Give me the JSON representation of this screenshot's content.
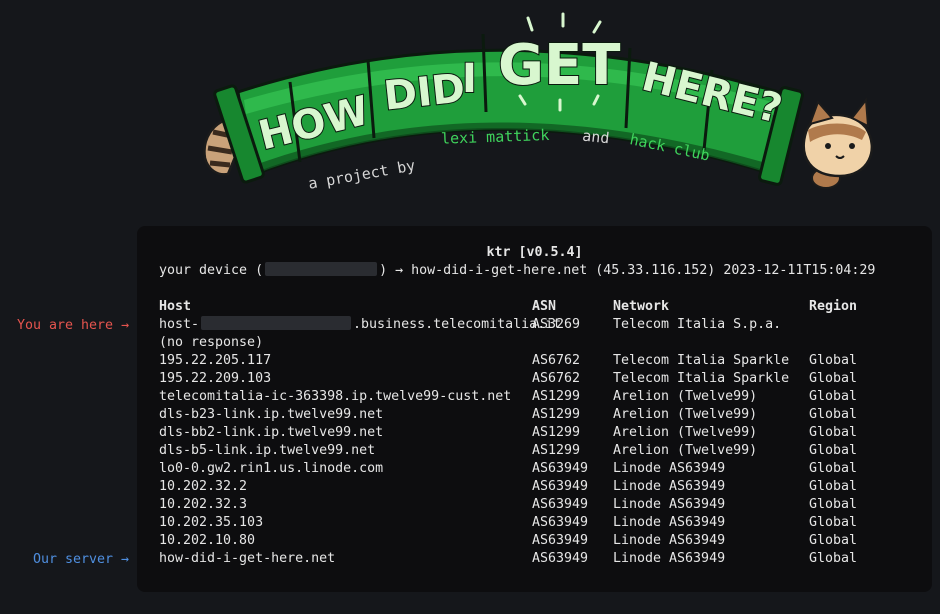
{
  "banner": {
    "title_words": [
      "HOW",
      "DID",
      "I",
      "GET",
      "HERE?"
    ],
    "subtitle_prefix": "a project by",
    "author": "lexi mattick",
    "subtitle_and": "and",
    "org": "hack club",
    "colors": {
      "tube": "#1f9e3b",
      "tube_dark": "#0f5a21",
      "text": "#d8f7cf",
      "accent_green": "#3fd45c"
    }
  },
  "terminal": {
    "title": "ktr [v0.5.4]",
    "header_prefix": "your device (",
    "header_mid": ") → how-did-i-get-here.net (45.33.116.152)",
    "timestamp": "2023-12-11T15:04:29",
    "columns": {
      "host": "Host",
      "asn": "ASN",
      "network": "Network",
      "region": "Region"
    },
    "hops": [
      {
        "host_prefix": "host-",
        "host_suffix": ".business.telecomitalia.it",
        "asn": "AS3269",
        "network": "Telecom Italia S.p.a.",
        "region": ""
      },
      {
        "host": "(no response)",
        "asn": "",
        "network": "",
        "region": ""
      },
      {
        "host": "195.22.205.117",
        "asn": "AS6762",
        "network": "Telecom Italia Sparkle",
        "region": "Global"
      },
      {
        "host": "195.22.209.103",
        "asn": "AS6762",
        "network": "Telecom Italia Sparkle",
        "region": "Global"
      },
      {
        "host": "telecomitalia-ic-363398.ip.twelve99-cust.net",
        "asn": "AS1299",
        "network": "Arelion (Twelve99)",
        "region": "Global"
      },
      {
        "host": "dls-b23-link.ip.twelve99.net",
        "asn": "AS1299",
        "network": "Arelion (Twelve99)",
        "region": "Global"
      },
      {
        "host": "dls-bb2-link.ip.twelve99.net",
        "asn": "AS1299",
        "network": "Arelion (Twelve99)",
        "region": "Global"
      },
      {
        "host": "dls-b5-link.ip.twelve99.net",
        "asn": "AS1299",
        "network": "Arelion (Twelve99)",
        "region": "Global"
      },
      {
        "host": "lo0-0.gw2.rin1.us.linode.com",
        "asn": "AS63949",
        "network": "Linode AS63949",
        "region": "Global"
      },
      {
        "host": "10.202.32.2",
        "asn": "AS63949",
        "network": "Linode AS63949",
        "region": "Global"
      },
      {
        "host": "10.202.32.3",
        "asn": "AS63949",
        "network": "Linode AS63949",
        "region": "Global"
      },
      {
        "host": "10.202.35.103",
        "asn": "AS63949",
        "network": "Linode AS63949",
        "region": "Global"
      },
      {
        "host": "10.202.10.80",
        "asn": "AS63949",
        "network": "Linode AS63949",
        "region": "Global"
      },
      {
        "host": "how-did-i-get-here.net",
        "asn": "AS63949",
        "network": "Linode AS63949",
        "region": "Global"
      }
    ]
  },
  "side_labels": {
    "you_are_here": "You are here →",
    "our_server": "Our server →",
    "colors": {
      "you_are_here": "#e5544e",
      "our_server": "#4f8fe0"
    }
  }
}
